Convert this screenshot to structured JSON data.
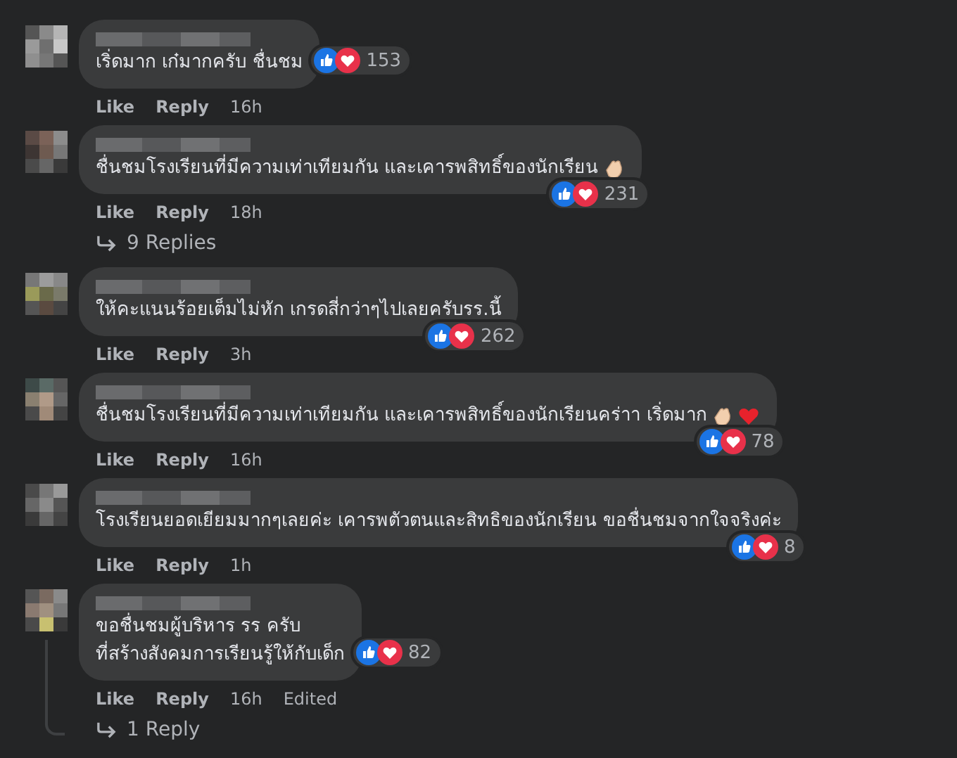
{
  "comments": [
    {
      "kind": "beside",
      "lines": [
        "เริ่ดมาก เก๋มากครับ ชื่นชม"
      ],
      "reactions": "153",
      "actions": [
        "Like",
        "Reply"
      ],
      "time": "16h"
    },
    {
      "kind": "corner",
      "lines": [
        "ชื่นชมโรงเรียนที่มีความเท่าเทียมกัน และเคารพสิทธิ์ของนักเรียน"
      ],
      "emojis": [
        {
          "kind": "clap"
        }
      ],
      "reactions": "231",
      "actions": [
        "Like",
        "Reply"
      ],
      "time": "18h",
      "replies": "9 Replies"
    },
    {
      "kind": "corner",
      "lines": [
        "ให้คะแนนร้อยเต็มไม่หัก เกรดสี่กว่าๆไปเลยครับรร.นี้"
      ],
      "reactions": "262",
      "actions": [
        "Like",
        "Reply"
      ],
      "time": "3h"
    },
    {
      "kind": "corner",
      "lines": [
        "ชื่นชมโรงเรียนที่มีความเท่าเทียมกัน และเคารพสิทธิ์ของนักเรียนคร่าา เริ่ดมาก"
      ],
      "emojis": [
        {
          "kind": "clap"
        },
        {
          "kind": "heart"
        }
      ],
      "reactions": "78",
      "actions": [
        "Like",
        "Reply"
      ],
      "time": "16h"
    },
    {
      "kind": "corner",
      "lines": [
        "โรงเรียนยอดเยียมมากๆเลยค่ะ เคารพตัวตนและสิทธิของนักเรียน ขอชื่นชมจากใจจริงค่ะ"
      ],
      "reactions": "8",
      "actions": [
        "Like",
        "Reply"
      ],
      "time": "1h"
    },
    {
      "kind": "beside",
      "lines": [
        "ขอชื่นชมผู้บริหาร รร ครับ",
        "ที่สร้างสังคมการเรียนรู้ให้กับเด็ก"
      ],
      "reactions": "82",
      "actions": [
        "Like",
        "Reply"
      ],
      "time": "16h",
      "edited": "Edited",
      "replies": "1 Reply",
      "thread": true
    }
  ]
}
